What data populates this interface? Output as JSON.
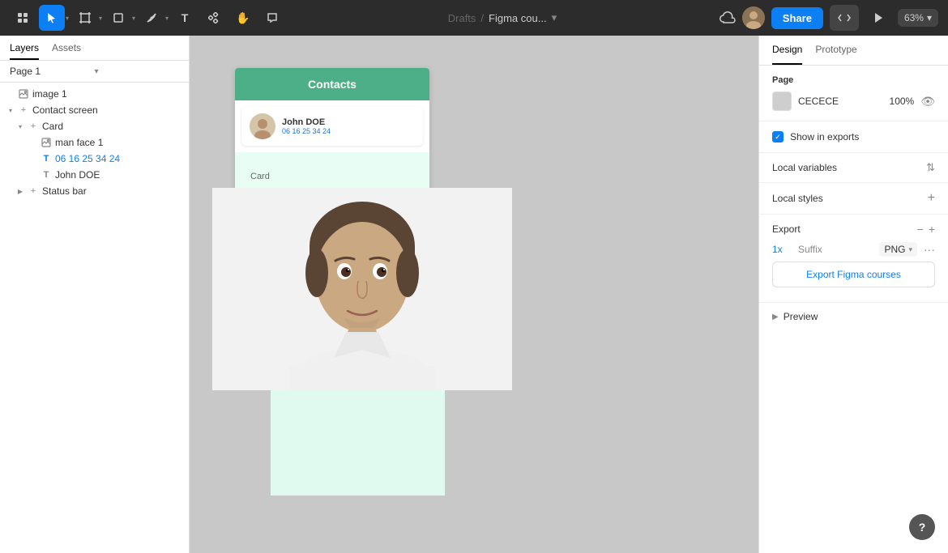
{
  "toolbar": {
    "title": "Drafts",
    "slash": "/",
    "filename": "Figma cou...",
    "share_label": "Share",
    "zoom_level": "63%",
    "tools": [
      {
        "id": "menu",
        "icon": "⊞",
        "active": false
      },
      {
        "id": "select",
        "icon": "▲",
        "active": true
      },
      {
        "id": "frame",
        "icon": "⬜",
        "active": false
      },
      {
        "id": "shape",
        "icon": "◻",
        "active": false
      },
      {
        "id": "pen",
        "icon": "✒",
        "active": false
      },
      {
        "id": "text",
        "icon": "T",
        "active": false
      },
      {
        "id": "component",
        "icon": "❖",
        "active": false
      },
      {
        "id": "hand",
        "icon": "✋",
        "active": false
      },
      {
        "id": "comment",
        "icon": "💬",
        "active": false
      }
    ]
  },
  "left_panel": {
    "tabs": [
      {
        "id": "layers",
        "label": "Layers",
        "active": true
      },
      {
        "id": "assets",
        "label": "Assets",
        "active": false
      }
    ],
    "page_selector": {
      "label": "Page 1",
      "arrow": "▾"
    },
    "layers": [
      {
        "id": "image1",
        "label": "image 1",
        "level": 0,
        "icon": "img",
        "icon_type": "image",
        "expanded": false
      },
      {
        "id": "contact-screen",
        "label": "Contact screen",
        "level": 0,
        "icon": "+",
        "icon_type": "frame",
        "expanded": true,
        "selected": false
      },
      {
        "id": "card",
        "label": "Card",
        "level": 1,
        "icon": "+",
        "icon_type": "frame",
        "expanded": true,
        "selected": false
      },
      {
        "id": "man-face-1",
        "label": "man face 1",
        "level": 2,
        "icon": "img",
        "icon_type": "image",
        "expanded": false
      },
      {
        "id": "phone-number",
        "label": "06 16 25 34 24",
        "level": 2,
        "icon": "T",
        "icon_type": "text",
        "expanded": false,
        "color": "blue"
      },
      {
        "id": "john-doe",
        "label": "John DOE",
        "level": 2,
        "icon": "T",
        "icon_type": "text",
        "expanded": false
      },
      {
        "id": "status-bar",
        "label": "Status bar",
        "level": 1,
        "icon": "+",
        "icon_type": "frame",
        "expanded": false
      }
    ]
  },
  "canvas": {
    "label": "Contact screen",
    "card_label": "Card",
    "header_text": "Contacts",
    "contact_name": "John DOE",
    "contact_phone": "06 16 25 34 24"
  },
  "right_panel": {
    "tabs": [
      {
        "id": "design",
        "label": "Design",
        "active": true
      },
      {
        "id": "prototype",
        "label": "Prototype",
        "active": false
      }
    ],
    "page_section": {
      "title": "Page",
      "color_hex": "CECECE",
      "color_opacity": "100%"
    },
    "show_in_exports": {
      "label": "Show in exports",
      "checked": true
    },
    "local_variables": {
      "title": "Local variables"
    },
    "local_styles": {
      "title": "Local styles"
    },
    "export": {
      "title": "Export",
      "scale": "1x",
      "suffix": "Suffix",
      "format": "PNG",
      "button_label": "Export Figma courses"
    },
    "preview": {
      "label": "Preview"
    }
  }
}
